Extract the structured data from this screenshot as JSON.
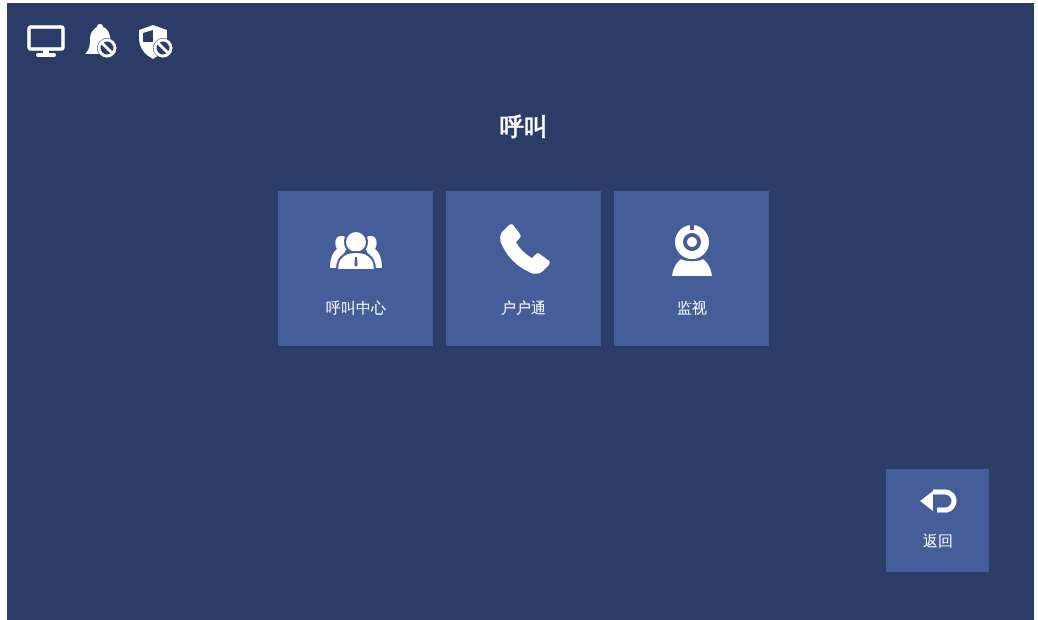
{
  "status_icons": [
    {
      "kind": "monitor"
    },
    {
      "kind": "bell_off"
    },
    {
      "kind": "shield_off"
    }
  ],
  "title": "呼叫",
  "tiles": [
    {
      "kind": "call_center",
      "label": "呼叫中心"
    },
    {
      "kind": "phone",
      "label": "户户通"
    },
    {
      "kind": "camera",
      "label": "监视"
    }
  ],
  "back_button": {
    "kind": "back",
    "label": "返回"
  }
}
